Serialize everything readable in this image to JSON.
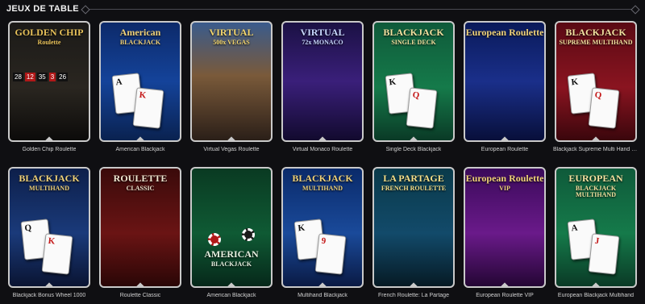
{
  "section": {
    "title": "JEUX DE TABLE"
  },
  "games": [
    {
      "name": "Golden Chip Roulette",
      "logo": "GOLDEN CHIP",
      "sub": "Roulette",
      "theme": "dark-gold",
      "art": "roulette-top",
      "numbers": [
        "28",
        "12",
        "35",
        "3",
        "26"
      ]
    },
    {
      "name": "American Blackjack",
      "logo": "American",
      "sub": "BLACKJACK",
      "theme": "blue-table",
      "art": "cards",
      "cards": [
        "A",
        "K"
      ]
    },
    {
      "name": "Virtual Vegas Roulette",
      "logo": "VIRTUAL",
      "sub": "500x VEGAS",
      "theme": "vegas",
      "art": "wheel"
    },
    {
      "name": "Virtual Monaco Roulette",
      "logo": "VIRTUAL",
      "sub": "72x MONACO",
      "theme": "monaco",
      "art": "wheel"
    },
    {
      "name": "Single Deck Blackjack",
      "logo": "BLACKJACK",
      "sub": "SINGLE DECK",
      "theme": "green-table",
      "art": "cards",
      "cards": [
        "K",
        "Q"
      ]
    },
    {
      "name": "European Roulette",
      "logo": "European Roulette",
      "sub": "",
      "theme": "navy",
      "art": "wheel"
    },
    {
      "name": "Blackjack Supreme Multi Hand Perfe...",
      "logo": "BLACKJACK",
      "sub": "SUPREME MULTIHAND",
      "theme": "red",
      "art": "cards",
      "cards": [
        "K",
        "Q"
      ]
    },
    {
      "name": "Blackjack Bonus Wheel 1000",
      "logo": "BLACKJACK",
      "sub": "MULTIHAND",
      "theme": "dark-blue",
      "art": "cards",
      "cards": [
        "Q",
        "K"
      ]
    },
    {
      "name": "Roulette Classic",
      "logo": "ROULETTE",
      "sub": "CLASSIC",
      "theme": "red-dark",
      "art": "wheel"
    },
    {
      "name": "American Blackjack",
      "logo": "AMERICAN",
      "sub": "BLACKJACK",
      "theme": "green",
      "art": "table"
    },
    {
      "name": "Multihand Blackjack",
      "logo": "BLACKJACK",
      "sub": "MULTIHAND",
      "theme": "blue",
      "art": "cards",
      "cards": [
        "K",
        "9"
      ]
    },
    {
      "name": "French Roulette: La Partage",
      "logo": "LA PARTAGE",
      "sub": "FRENCH ROULETTE",
      "theme": "teal",
      "art": "wheel-blue"
    },
    {
      "name": "European Roulette VIP",
      "logo": "European Roulette",
      "sub": "VIP",
      "theme": "purple",
      "art": "wheel"
    },
    {
      "name": "European Blackjack Multihand",
      "logo": "EUROPEAN",
      "sub": "BLACKJACK MULTIHAND",
      "theme": "green-table",
      "art": "cards",
      "cards": [
        "A",
        "J"
      ]
    }
  ]
}
